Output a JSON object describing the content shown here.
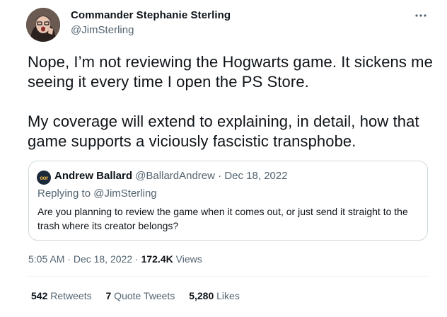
{
  "author": {
    "name": "Commander Stephanie Sterling",
    "handle": "@JimSterling"
  },
  "tweet": {
    "paragraph1": "Nope, I’m not reviewing the Hogwarts game. It sickens me seeing it every time I open the PS Store.",
    "paragraph2": "My coverage will extend to explaining, in detail, how that game supports a viciously fascistic transphobe."
  },
  "quote": {
    "avatar_text": "oor",
    "name": "Andrew Ballard",
    "handle": "@BallardAndrew",
    "separator": " · ",
    "date": "Dec 18, 2022",
    "replying_to": "Replying to @JimSterling",
    "text": "Are you planning to review the game when it comes out, or just send it straight to the trash where its creator belongs?"
  },
  "meta": {
    "time": "5:05 AM",
    "separator": " · ",
    "date": "Dec 18, 2022",
    "separator2": " · ",
    "views_count": "172.4K",
    "views_label": " Views"
  },
  "stats": {
    "retweets_count": "542",
    "retweets_label": " Retweets",
    "quotes_count": "7",
    "quotes_label": " Quote Tweets",
    "likes_count": "5,280",
    "likes_label": " Likes"
  },
  "icons": {
    "more": "more-horizontal-icon"
  },
  "colors": {
    "text": "#0f1419",
    "secondary": "#536471",
    "border": "#cfd9de"
  }
}
